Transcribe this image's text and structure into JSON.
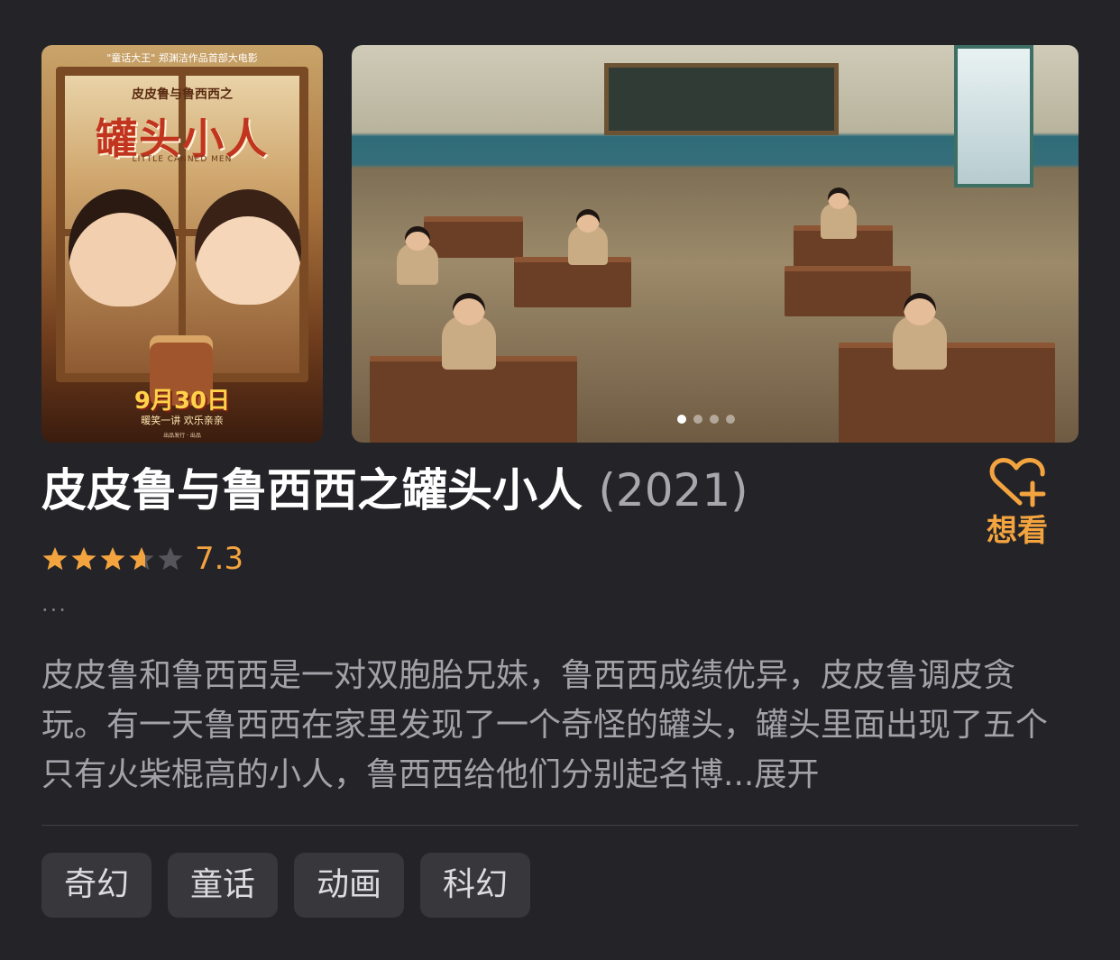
{
  "poster": {
    "top_line": "\"童话大王\" 郑渊洁作品首部大电影",
    "subtitle": "皮皮鲁与鲁西西之",
    "title": "罐头小人",
    "english_title": "LITTLE CANNED MEN",
    "release_date": "9月30日",
    "tagline": "暖笑一讲  欢乐亲亲",
    "credits": "出品发行 · 出品"
  },
  "gallery": {
    "image_count": 4,
    "active_index": 0
  },
  "movie": {
    "title": "皮皮鲁与鲁西西之罐头小人",
    "year": "(2021)",
    "rating_value": 7.3,
    "rating_text": "7.3",
    "star_count": 5,
    "ellipsis": "...",
    "synopsis": "皮皮鲁和鲁西西是一对双胞胎兄妹，鲁西西成绩优异，皮皮鲁调皮贪玩。有一天鲁西西在家里发现了一个奇怪的罐头，罐头里面出现了五个只有火柴棍高的小人，鲁西西给他们分别起名博...",
    "expand_label": "展开"
  },
  "actions": {
    "want_label": "想看",
    "want_icon": "heart-plus-icon"
  },
  "tags": [
    "奇幻",
    "童话",
    "动画",
    "科幻"
  ],
  "colors": {
    "background": "#232328",
    "accent": "#f3a43f",
    "tag_bg": "#37373c"
  }
}
